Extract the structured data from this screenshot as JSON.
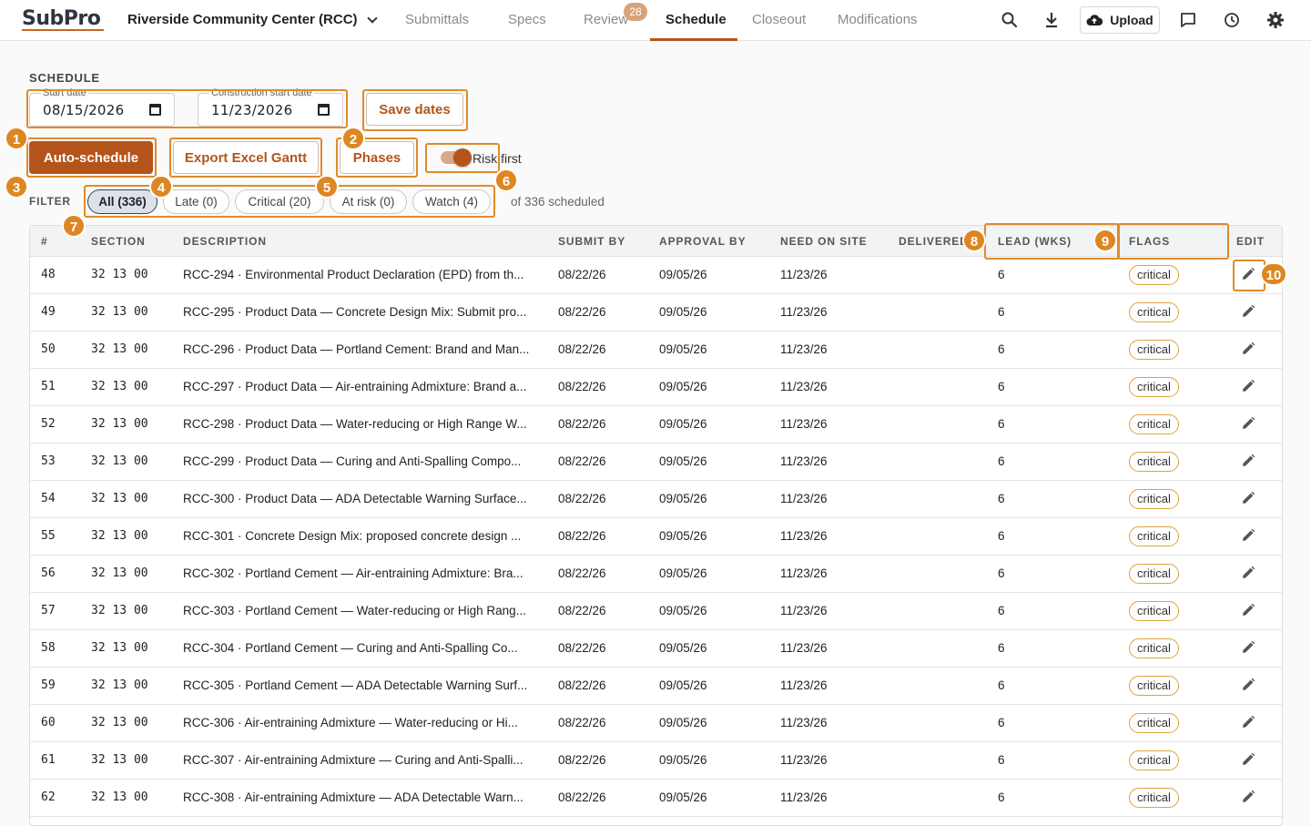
{
  "brand": {
    "logo_sub": "Sub",
    "logo_pro": "Pro"
  },
  "project": {
    "name": "Riverside Community Center (RCC)"
  },
  "nav": {
    "tabs": [
      {
        "label": "Submittals"
      },
      {
        "label": "Specs"
      },
      {
        "label": "Review",
        "badge": "28"
      },
      {
        "label": "Schedule"
      },
      {
        "label": "Closeout"
      },
      {
        "label": "Modifications"
      }
    ],
    "active": "Schedule",
    "upload_label": "Upload"
  },
  "schedule": {
    "title": "SCHEDULE",
    "start_date_label": "Start date",
    "start_date": "08/15/2026",
    "construction_start_label": "Construction start date",
    "construction_start": "11/23/2026",
    "save_dates_label": "Save dates",
    "auto_schedule_label": "Auto-schedule",
    "export_label": "Export Excel Gantt",
    "phases_label": "Phases",
    "risk_first_label": "Risk first",
    "risk_first_on": true
  },
  "filter": {
    "label": "FILTER",
    "chips": [
      "All (336)",
      "Late (0)",
      "Critical (20)",
      "At risk (0)",
      "Watch (4)"
    ],
    "active": "All (336)",
    "note": "of 336 scheduled"
  },
  "table": {
    "columns": [
      "#",
      "SECTION",
      "DESCRIPTION",
      "SUBMIT BY",
      "APPROVAL BY",
      "NEED ON SITE",
      "DELIVERED",
      "LEAD (WKS)",
      "FLAGS",
      "EDIT"
    ],
    "rows": [
      {
        "num": "48",
        "section": "32 13 00",
        "desc": "RCC-294 · Environmental Product Declaration (EPD) from th...",
        "submit": "08/22/26",
        "approval": "09/05/26",
        "need": "11/23/26",
        "delivered": "",
        "lead": "6",
        "flag": "critical"
      },
      {
        "num": "49",
        "section": "32 13 00",
        "desc": "RCC-295 · Product Data — Concrete Design Mix: Submit pro...",
        "submit": "08/22/26",
        "approval": "09/05/26",
        "need": "11/23/26",
        "delivered": "",
        "lead": "6",
        "flag": "critical"
      },
      {
        "num": "50",
        "section": "32 13 00",
        "desc": "RCC-296 · Product Data — Portland Cement: Brand and Man...",
        "submit": "08/22/26",
        "approval": "09/05/26",
        "need": "11/23/26",
        "delivered": "",
        "lead": "6",
        "flag": "critical"
      },
      {
        "num": "51",
        "section": "32 13 00",
        "desc": "RCC-297 · Product Data — Air-entraining Admixture: Brand a...",
        "submit": "08/22/26",
        "approval": "09/05/26",
        "need": "11/23/26",
        "delivered": "",
        "lead": "6",
        "flag": "critical"
      },
      {
        "num": "52",
        "section": "32 13 00",
        "desc": "RCC-298 · Product Data — Water-reducing or High Range W...",
        "submit": "08/22/26",
        "approval": "09/05/26",
        "need": "11/23/26",
        "delivered": "",
        "lead": "6",
        "flag": "critical"
      },
      {
        "num": "53",
        "section": "32 13 00",
        "desc": "RCC-299 · Product Data — Curing and Anti-Spalling Compo...",
        "submit": "08/22/26",
        "approval": "09/05/26",
        "need": "11/23/26",
        "delivered": "",
        "lead": "6",
        "flag": "critical"
      },
      {
        "num": "54",
        "section": "32 13 00",
        "desc": "RCC-300 · Product Data — ADA Detectable Warning Surface...",
        "submit": "08/22/26",
        "approval": "09/05/26",
        "need": "11/23/26",
        "delivered": "",
        "lead": "6",
        "flag": "critical"
      },
      {
        "num": "55",
        "section": "32 13 00",
        "desc": "RCC-301 · Concrete Design Mix: proposed concrete design ...",
        "submit": "08/22/26",
        "approval": "09/05/26",
        "need": "11/23/26",
        "delivered": "",
        "lead": "6",
        "flag": "critical"
      },
      {
        "num": "56",
        "section": "32 13 00",
        "desc": "RCC-302 · Portland Cement — Air-entraining Admixture: Bra...",
        "submit": "08/22/26",
        "approval": "09/05/26",
        "need": "11/23/26",
        "delivered": "",
        "lead": "6",
        "flag": "critical"
      },
      {
        "num": "57",
        "section": "32 13 00",
        "desc": "RCC-303 · Portland Cement — Water-reducing or High Rang...",
        "submit": "08/22/26",
        "approval": "09/05/26",
        "need": "11/23/26",
        "delivered": "",
        "lead": "6",
        "flag": "critical"
      },
      {
        "num": "58",
        "section": "32 13 00",
        "desc": "RCC-304 · Portland Cement — Curing and Anti-Spalling Co...",
        "submit": "08/22/26",
        "approval": "09/05/26",
        "need": "11/23/26",
        "delivered": "",
        "lead": "6",
        "flag": "critical"
      },
      {
        "num": "59",
        "section": "32 13 00",
        "desc": "RCC-305 · Portland Cement — ADA Detectable Warning Surf...",
        "submit": "08/22/26",
        "approval": "09/05/26",
        "need": "11/23/26",
        "delivered": "",
        "lead": "6",
        "flag": "critical"
      },
      {
        "num": "60",
        "section": "32 13 00",
        "desc": "RCC-306 · Air-entraining Admixture — Water-reducing or Hi...",
        "submit": "08/22/26",
        "approval": "09/05/26",
        "need": "11/23/26",
        "delivered": "",
        "lead": "6",
        "flag": "critical"
      },
      {
        "num": "61",
        "section": "32 13 00",
        "desc": "RCC-307 · Air-entraining Admixture — Curing and Anti-Spalli...",
        "submit": "08/22/26",
        "approval": "09/05/26",
        "need": "11/23/26",
        "delivered": "",
        "lead": "6",
        "flag": "critical"
      },
      {
        "num": "62",
        "section": "32 13 00",
        "desc": "RCC-308 · Air-entraining Admixture — ADA Detectable Warn...",
        "submit": "08/22/26",
        "approval": "09/05/26",
        "need": "11/23/26",
        "delivered": "",
        "lead": "6",
        "flag": "critical"
      }
    ]
  },
  "annotations": {
    "markers": [
      "1",
      "2",
      "3",
      "4",
      "5",
      "6",
      "7",
      "8",
      "9",
      "10"
    ],
    "color": "#dd8722"
  },
  "colors": {
    "accent": "#b5541a",
    "flag_border": "#e0a23a",
    "highlight": "#e08a2b"
  }
}
